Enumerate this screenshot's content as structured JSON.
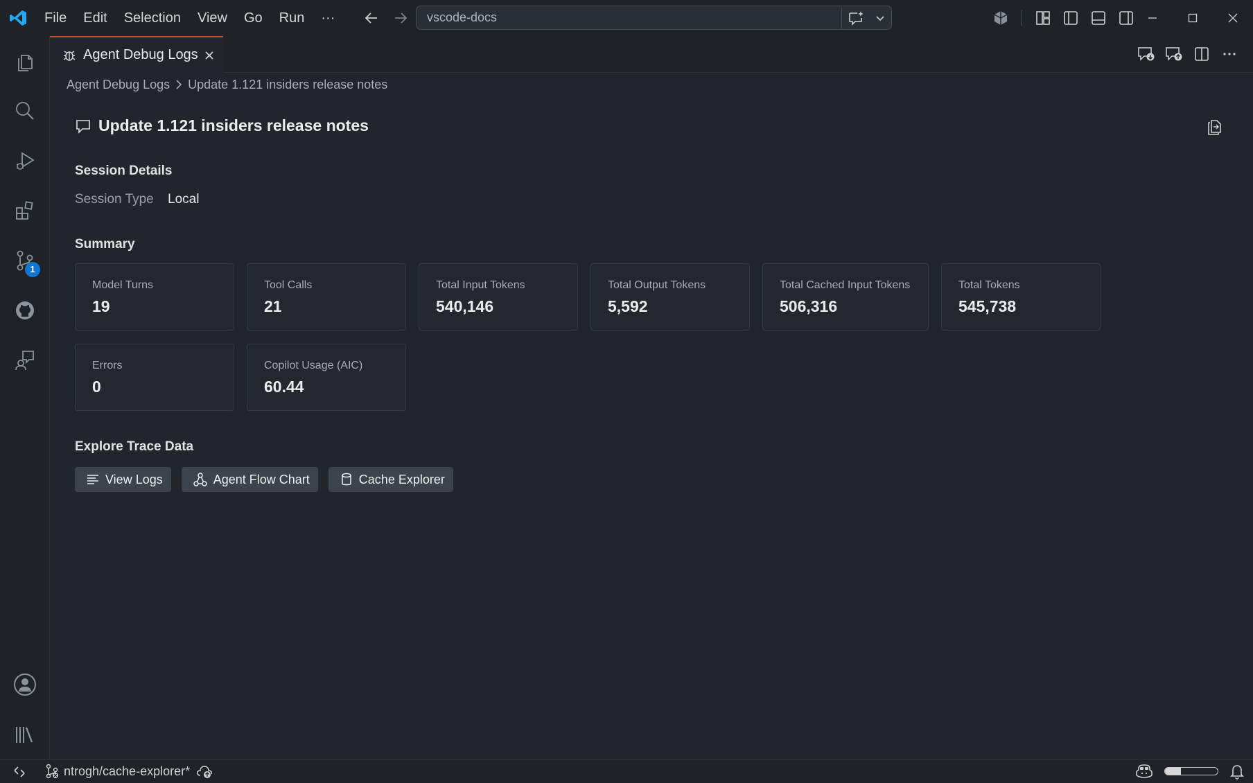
{
  "menu": [
    "File",
    "Edit",
    "Selection",
    "View",
    "Go",
    "Run",
    "···"
  ],
  "search": {
    "text": "vscode-docs"
  },
  "activity_badge": "1",
  "tab": {
    "label": "Agent Debug Logs"
  },
  "breadcrumb": {
    "root": "Agent Debug Logs",
    "current": "Update 1.121 insiders release notes"
  },
  "page": {
    "title": "Update 1.121 insiders release notes"
  },
  "session_details": {
    "heading": "Session Details",
    "type_label": "Session Type",
    "type_value": "Local"
  },
  "summary": {
    "heading": "Summary",
    "cards": [
      {
        "label": "Model Turns",
        "value": "19"
      },
      {
        "label": "Tool Calls",
        "value": "21"
      },
      {
        "label": "Total Input Tokens",
        "value": "540,146"
      },
      {
        "label": "Total Output Tokens",
        "value": "5,592"
      },
      {
        "label": "Total Cached Input Tokens",
        "value": "506,316"
      },
      {
        "label": "Total Tokens",
        "value": "545,738"
      },
      {
        "label": "Errors",
        "value": "0"
      },
      {
        "label": "Copilot Usage (AIC)",
        "value": "60.44"
      }
    ]
  },
  "explore": {
    "heading": "Explore Trace Data",
    "buttons": [
      "View Logs",
      "Agent Flow Chart",
      "Cache Explorer"
    ]
  },
  "status": {
    "branch": "ntrogh/cache-explorer*",
    "usage_fraction": 0.3
  },
  "colors": {
    "accent": "#0e78d5",
    "tab_border": "#c1523a",
    "logo": "#23a9f2"
  },
  "icons": [
    "vscode-logo-icon",
    "explorer-icon",
    "search-icon",
    "run-debug-icon",
    "extensions-icon",
    "source-control-icon",
    "github-icon",
    "chat-icon",
    "account-icon",
    "library-icon",
    "bug-icon",
    "comment-icon",
    "copy-icon",
    "list-icon",
    "flow-icon",
    "database-icon",
    "bell-icon",
    "copilot-icon"
  ]
}
